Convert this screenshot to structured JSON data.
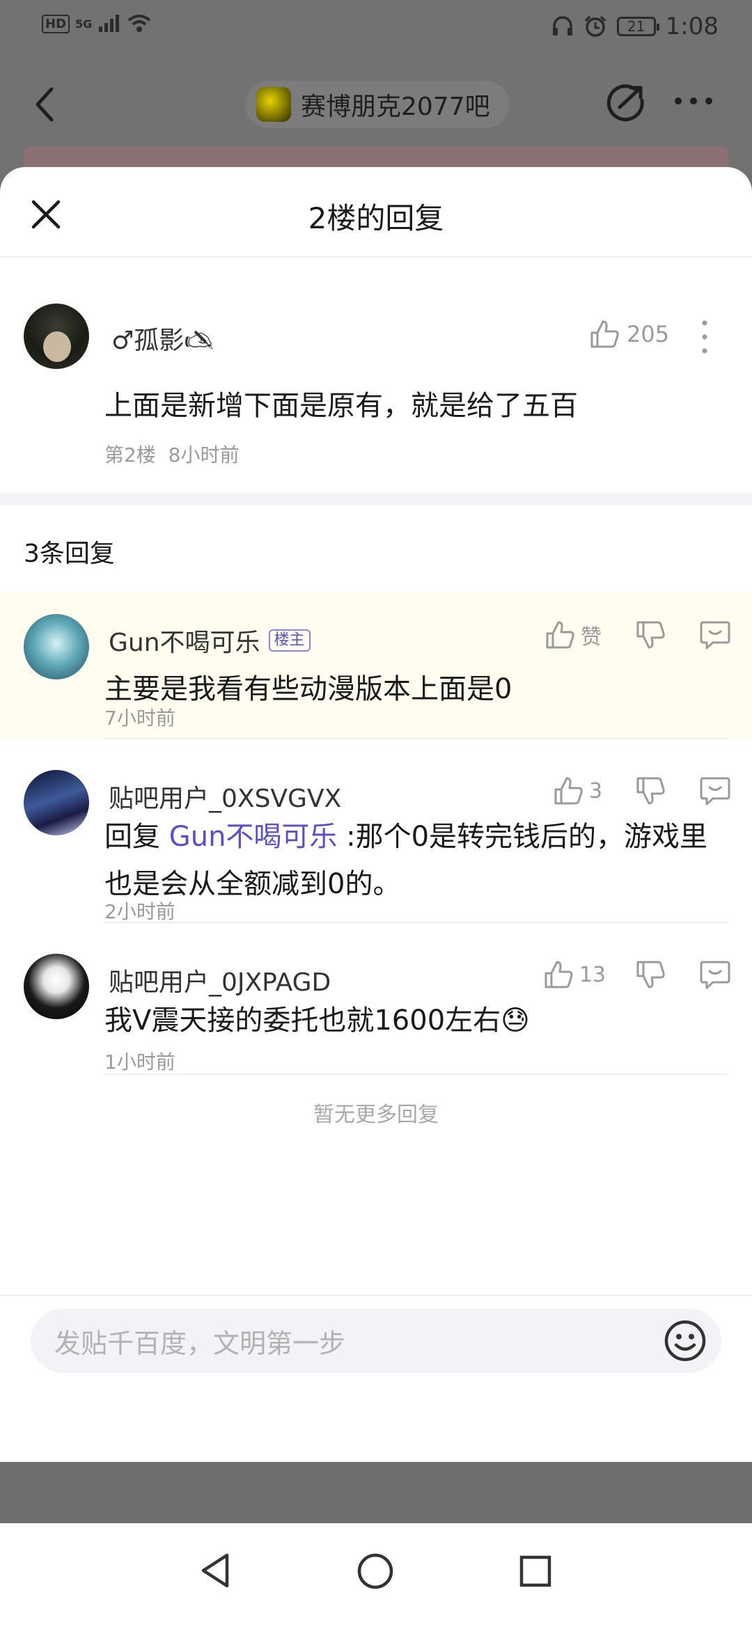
{
  "status_bar": {
    "hd": "HD",
    "network": "5G",
    "battery": "21",
    "time": "1:08"
  },
  "top_nav": {
    "forum_name": "赛博朋克2077吧"
  },
  "sheet": {
    "title": "2楼的回复"
  },
  "main_post": {
    "author": "♂孤影🖎",
    "likes": "205",
    "content": "上面是新增下面是原有，就是给了五百",
    "floor": "第2楼",
    "time": "8小时前"
  },
  "replies_header": "3条回复",
  "replies": [
    {
      "author": "Gun不喝可乐",
      "badge": "楼主",
      "like_label": "赞",
      "content": "主要是我看有些动漫版本上面是0",
      "time": "7小时前"
    },
    {
      "author": "贴吧用户_0XSVGVX",
      "like_label": "3",
      "reply_prefix": "回复 ",
      "mention": "Gun不喝可乐",
      "content": " :那个0是转完钱后的，游戏里也是会从全额减到0的。",
      "time": "2小时前"
    },
    {
      "author": "贴吧用户_0JXPAGD",
      "like_label": "13",
      "content": "我V震天接的委托也就1600左右",
      "emoji": "😓",
      "time": "1小时前"
    }
  ],
  "no_more": "暂无更多回复",
  "input": {
    "placeholder": "发贴千百度，文明第一步"
  },
  "colors": {
    "accent": "#5b4fc6",
    "highlight_bg": "#fefdf0",
    "muted_text": "#9a9a9a"
  },
  "icons": {
    "close": "close-icon",
    "like": "thumb-up-icon",
    "dislike": "thumb-down-icon",
    "comment": "comment-icon",
    "emoji": "smiley-icon"
  }
}
